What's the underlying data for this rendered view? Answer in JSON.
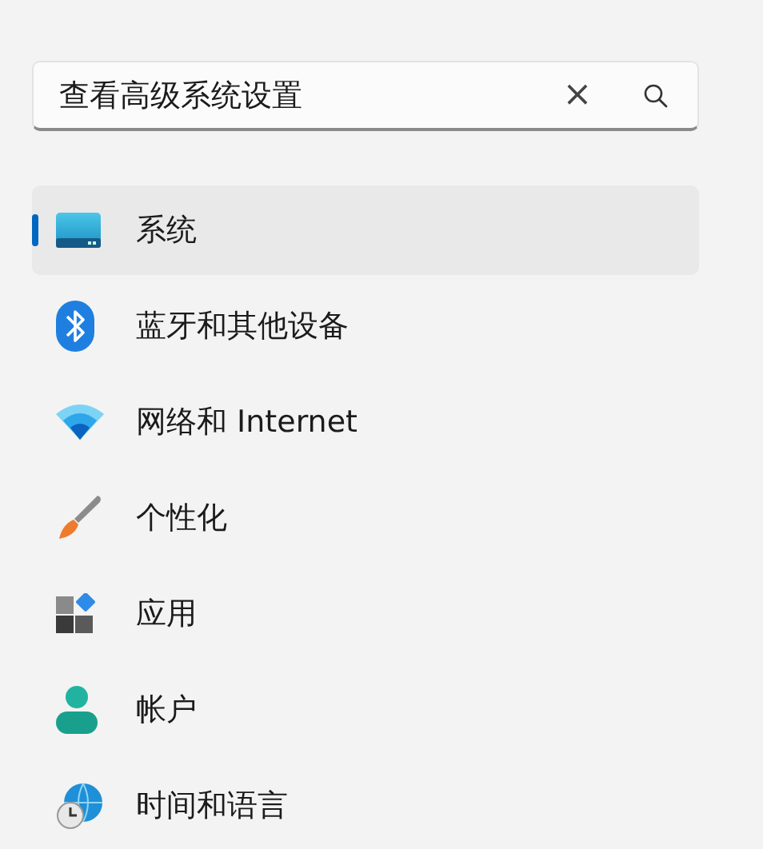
{
  "search": {
    "value": "查看高级系统设置",
    "clear_icon": "×"
  },
  "nav": [
    {
      "kind": "system",
      "label": "系统",
      "selected": true
    },
    {
      "kind": "bluetooth",
      "label": "蓝牙和其他设备",
      "selected": false
    },
    {
      "kind": "network",
      "label": "网络和 Internet",
      "selected": false
    },
    {
      "kind": "personalization",
      "label": "个性化",
      "selected": false
    },
    {
      "kind": "apps",
      "label": "应用",
      "selected": false
    },
    {
      "kind": "accounts",
      "label": "帐户",
      "selected": false
    },
    {
      "kind": "time",
      "label": "时间和语言",
      "selected": false
    }
  ]
}
